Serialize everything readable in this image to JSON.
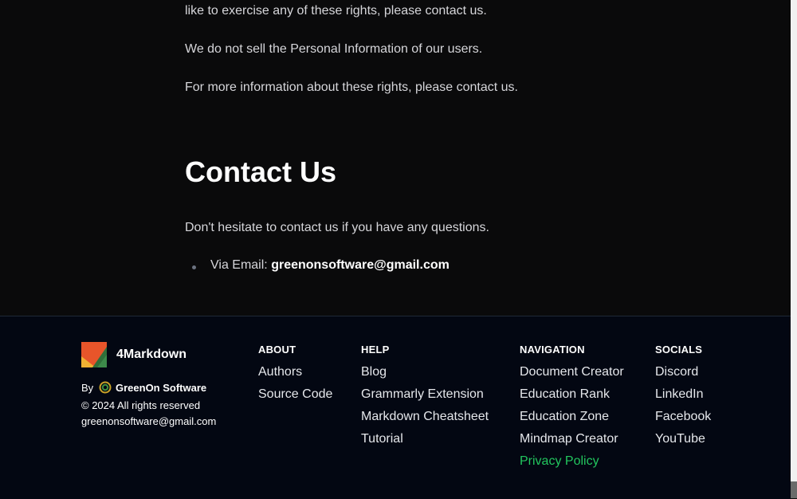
{
  "content": {
    "paragraphs": [
      "like to exercise any of these rights, please contact us.",
      "We do not sell the Personal Information of our users.",
      "For more information about these rights, please contact us."
    ],
    "contact_heading": "Contact Us",
    "contact_intro": "Don't hesitate to contact us if you have any questions.",
    "contact_bullet_prefix": "Via Email: ",
    "contact_email": "greenonsoftware@gmail.com"
  },
  "footer": {
    "brand_name": "4Markdown",
    "by_label": "By",
    "company_name": "GreenOn Software",
    "copyright": "© 2024 All rights reserved",
    "email": "greenonsoftware@gmail.com",
    "columns": [
      {
        "title": "ABOUT",
        "links": [
          "Authors",
          "Source Code"
        ]
      },
      {
        "title": "HELP",
        "links": [
          "Blog",
          "Grammarly Extension",
          "Markdown Cheatsheet",
          "Tutorial"
        ]
      },
      {
        "title": "NAVIGATION",
        "links": [
          "Document Creator",
          "Education Rank",
          "Education Zone",
          "Mindmap Creator",
          "Privacy Policy"
        ]
      },
      {
        "title": "SOCIALS",
        "links": [
          "Discord",
          "LinkedIn",
          "Facebook",
          "YouTube"
        ]
      }
    ],
    "active_link": "Privacy Policy"
  },
  "colors": {
    "page_bg": "#0a0a0b",
    "footer_bg": "#030712",
    "active_link": "#22c55e"
  },
  "icons": {
    "brand_logo": "4markdown-logo-icon",
    "company_logo": "greenon-logo-icon"
  }
}
